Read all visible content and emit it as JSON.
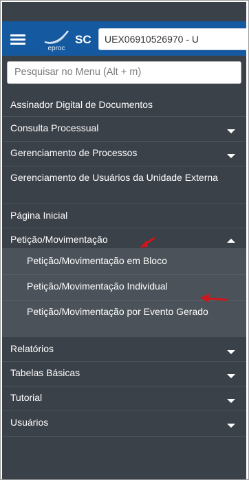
{
  "header": {
    "logo_text": "eproc",
    "state": "SC",
    "user_value": "UEX06910526970 - U",
    "brand_color": "#155aa0"
  },
  "search": {
    "placeholder": "Pesquisar no Menu (Alt + m)"
  },
  "menu": {
    "items": [
      {
        "label": "Assinador Digital de Documentos",
        "chevron": "none"
      },
      {
        "label": "Consulta Processual",
        "chevron": "down"
      },
      {
        "label": "Gerenciamento de Processos",
        "chevron": "down"
      },
      {
        "label": "Gerenciamento de Usuários da Unidade Externa",
        "chevron": "none"
      },
      {
        "label": "Página Inicial",
        "chevron": "none"
      },
      {
        "label": "Petição/Movimentação",
        "chevron": "up"
      },
      {
        "label": "Relatórios",
        "chevron": "down"
      },
      {
        "label": "Tabelas Básicas",
        "chevron": "down"
      },
      {
        "label": "Tutorial",
        "chevron": "down"
      },
      {
        "label": "Usuários",
        "chevron": "down"
      }
    ],
    "submenu": [
      {
        "label": "Petição/Movimentação em Bloco"
      },
      {
        "label": "Petição/Movimentação Individual"
      },
      {
        "label": "Petição/Movimentação por Evento Gerado"
      }
    ]
  },
  "colors": {
    "sidebar_bg": "#3b4149",
    "submenu_bg": "#4b525a",
    "annotation_arrow": "#d0161c"
  }
}
